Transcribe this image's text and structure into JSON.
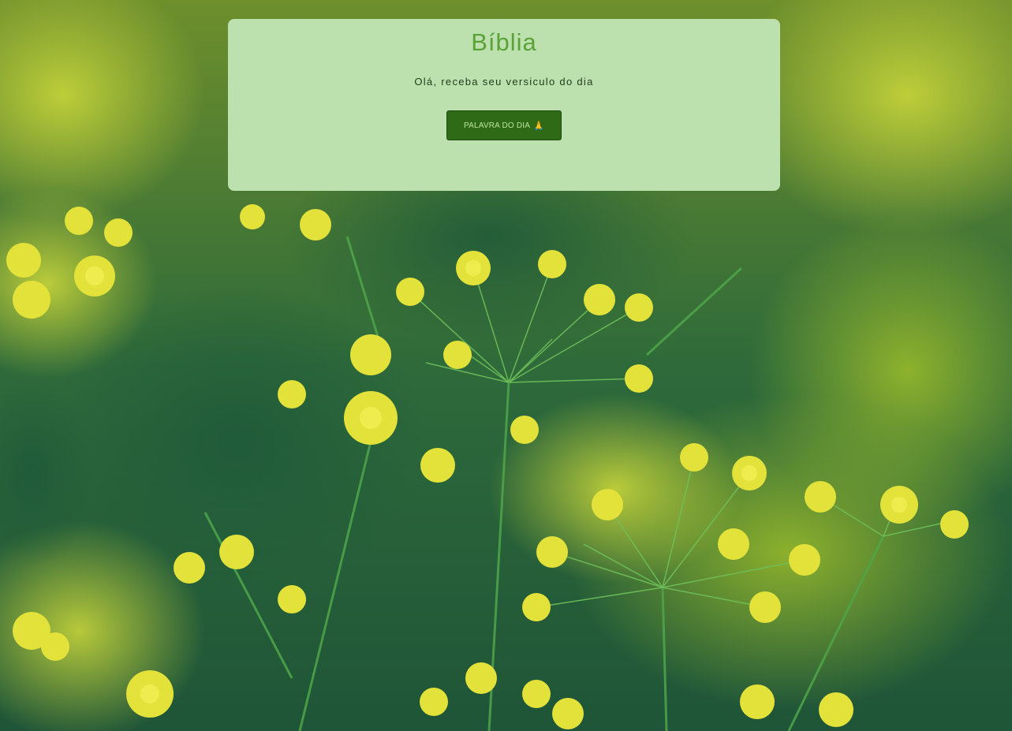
{
  "card": {
    "title": "Bíblia",
    "subtitle": "Olá, receba seu versiculo do dia",
    "button_label": "PALAVRA DO DIA",
    "button_emoji": "🙏"
  },
  "colors": {
    "card_bg": "#bde1ae",
    "title": "#5aa238",
    "button_bg": "#2f6b16",
    "button_text": "#b9e39b"
  },
  "background": {
    "subject": "dill-flowers-photo"
  }
}
